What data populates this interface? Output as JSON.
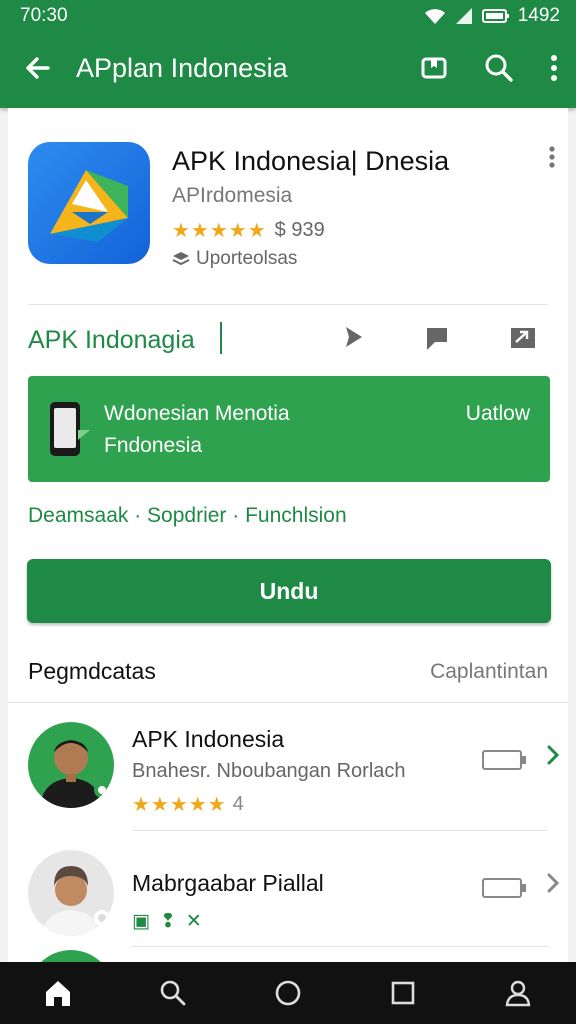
{
  "status_bar": {
    "time": "70:30",
    "battery": "1492"
  },
  "app_bar": {
    "title": "APplan Indonesia"
  },
  "app": {
    "title": "APK Indonesia| Dnesia",
    "developer": "APIrdomesia",
    "rating_stars": "★★★★★",
    "rating_text": "$ 939",
    "tag": "Uporteolsas"
  },
  "sub_bar": {
    "name": "APK Indonagia"
  },
  "banner": {
    "line1": "Wdonesian Menotia",
    "line2": "Fndonesia",
    "action": "Uatlow"
  },
  "tags": "Deamsaak · Sopdrier · Funchlsion",
  "download_button": "Undu",
  "section": {
    "title": "Pegmdcatas",
    "link": "Caplantintan"
  },
  "list": [
    {
      "title": "APK Indonesia",
      "subtitle": "Bnahesr. Nboubangan Rorlach",
      "stars": "★★★★★",
      "rating": "4",
      "accent": "#1e8a45"
    },
    {
      "title": "Mabrgaabar Piallal",
      "subtitle": "",
      "stars": "",
      "rating": "",
      "accent": "#888888"
    }
  ],
  "colors": {
    "primary": "#1e8a45",
    "banner": "#2ea24f",
    "star": "#f0a81b"
  },
  "icons": [
    "back-icon",
    "bookmark-icon",
    "search-icon",
    "more-icon",
    "play-icon",
    "flag-icon",
    "share-icon",
    "home-icon",
    "circle-icon",
    "square-icon",
    "profile-icon"
  ]
}
